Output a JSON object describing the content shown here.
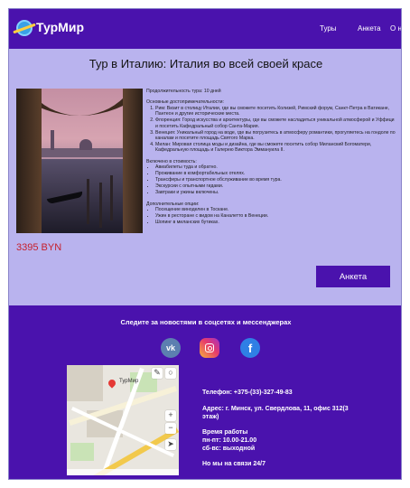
{
  "header": {
    "logo_text": "ТурМир",
    "nav": [
      "Туры",
      "Анкета",
      "О нас"
    ]
  },
  "main": {
    "title": "Тур в Италию: Италия во всей своей красе",
    "price": "3395 BYN",
    "duration": "Продолжительность тура: 10 дней",
    "sights_heading": "Основные достопримечательности:",
    "sights": [
      "Рим: Визит в столицу Италии, где вы сможете посетить Колизей, Римский форум, Санкт-Петра в Ватикане, Пантеон и другие исторические места.",
      "Флоренция: Город искусства и архитектуры, где вы сможете насладиться уникальной атмосферой и Уффици и посетить Кафедральный собор Санта-Мария.",
      "Венеция: Уникальный город на воде, где вы погрузитесь в атмосферу романтики, прогуляетесь на гондоле по каналам и посетите площадь Святого Марка.",
      "Милан: Мировая столица моды и дизайна, где вы сможете посетить собор Миланский Богоматери, Кафедральную площадь и Галерею Виктора Эммануила II."
    ],
    "included_heading": "Включено в стоимость:",
    "included": [
      "Авиабилеты туда и обратно.",
      "Проживание в комфортабельных отелях.",
      "Трансферы и транспортное обслуживание во время тура.",
      "Экскурсии с опытными гидами.",
      "Завтраки и ужины включены."
    ],
    "extra_heading": "Дополнительные опции:",
    "extra": [
      "Посещение виноделен в Тоскане.",
      "Ужин в ресторане с видом на Каналетто в Венеции.",
      "Шопинг в миланских бутиках."
    ],
    "anketa_button": "Анкета"
  },
  "footer": {
    "follow_text": "Следите за новостями в соцсетях и мессенджерах",
    "social": [
      {
        "name": "vk",
        "label": "vk"
      },
      {
        "name": "instagram",
        "label": ""
      },
      {
        "name": "facebook",
        "label": "f"
      }
    ],
    "map": {
      "label": "ТурМир"
    },
    "phone": "Телефон: +375-(33)-327-49-83",
    "address_line1": "Адрес: г. Минск, ул. Свердлова, 11, офис 312(3",
    "address_line2": "этаж)",
    "hours_title": "Время работы",
    "hours_weekdays": "пн-пт: 10.00-21.00",
    "hours_weekend": "сб-вс: выходной",
    "online": "Но мы на связи 24/7"
  },
  "colors": {
    "header_bg": "#4a12ad",
    "page_bg": "#b9b3ee",
    "price": "#c6202c",
    "button_bg": "#4a12ad"
  }
}
